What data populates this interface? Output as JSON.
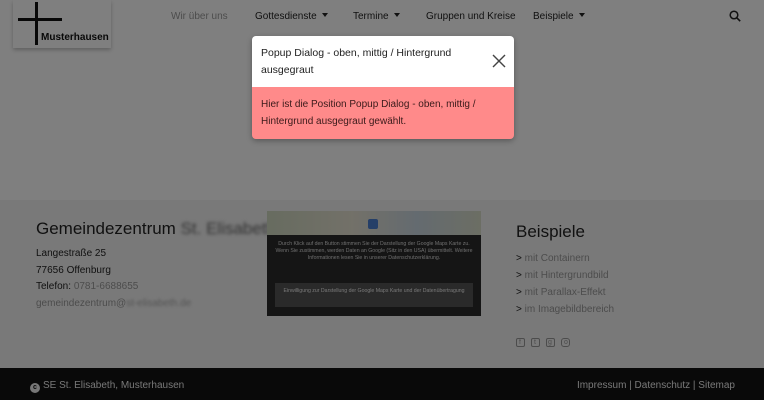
{
  "header": {
    "logo_text": "Musterhausen",
    "nav": [
      {
        "label": "Wir über uns"
      },
      {
        "label": "Gottesdienste"
      },
      {
        "label": "Termine"
      },
      {
        "label": "Gruppen und Kreise"
      },
      {
        "label": "Beispiele"
      }
    ],
    "search_icon": "search-icon"
  },
  "dialog": {
    "title": "Popup Dialog - oben, mittig / Hintergrund ausgegraut",
    "body": "Hier ist die Position Popup Dialog - oben, mittig / Hintergrund ausgegraut gewählt.",
    "close_icon": "close-icon",
    "body_color": "#ff8a8a"
  },
  "footer": {
    "title_prefix": "Gemeindezentrum",
    "title_blurred": "St. Elisabeth",
    "street": "Langestraße 25",
    "city": "77656 Offenburg",
    "phone_label": "Telefon:",
    "phone_value": "0781-6688655",
    "email_prefix": "gemeindezentrum@",
    "email_blurred": "st-elisabeth.de",
    "map_notice": "Durch Klick auf den Button stimmen Sie der Darstellung der Google Maps Karte zu. Wenn Sie zustimmen, werden Daten an Google (Sitz in den USA) übermittelt. Weitere Informationen lesen Sie in unserer Datenschutzerklärung.",
    "map_button": "Einwilligung zur Darstellung der Google Maps Karte und der Datenübertragung",
    "examples_title": "Beispiele",
    "examples": [
      {
        "label": "mit Containern"
      },
      {
        "label": "mit Hintergrundbild"
      },
      {
        "label": "mit Parallax-Effekt"
      },
      {
        "label": "im Imagebildbereich"
      }
    ],
    "social": [
      "facebook-icon",
      "twitter-icon",
      "google-plus-icon",
      "instagram-icon"
    ]
  },
  "bottom": {
    "copyright": "SE St. Elisabeth, Musterhausen",
    "links": "Impressum | Datenschutz | Sitemap"
  }
}
